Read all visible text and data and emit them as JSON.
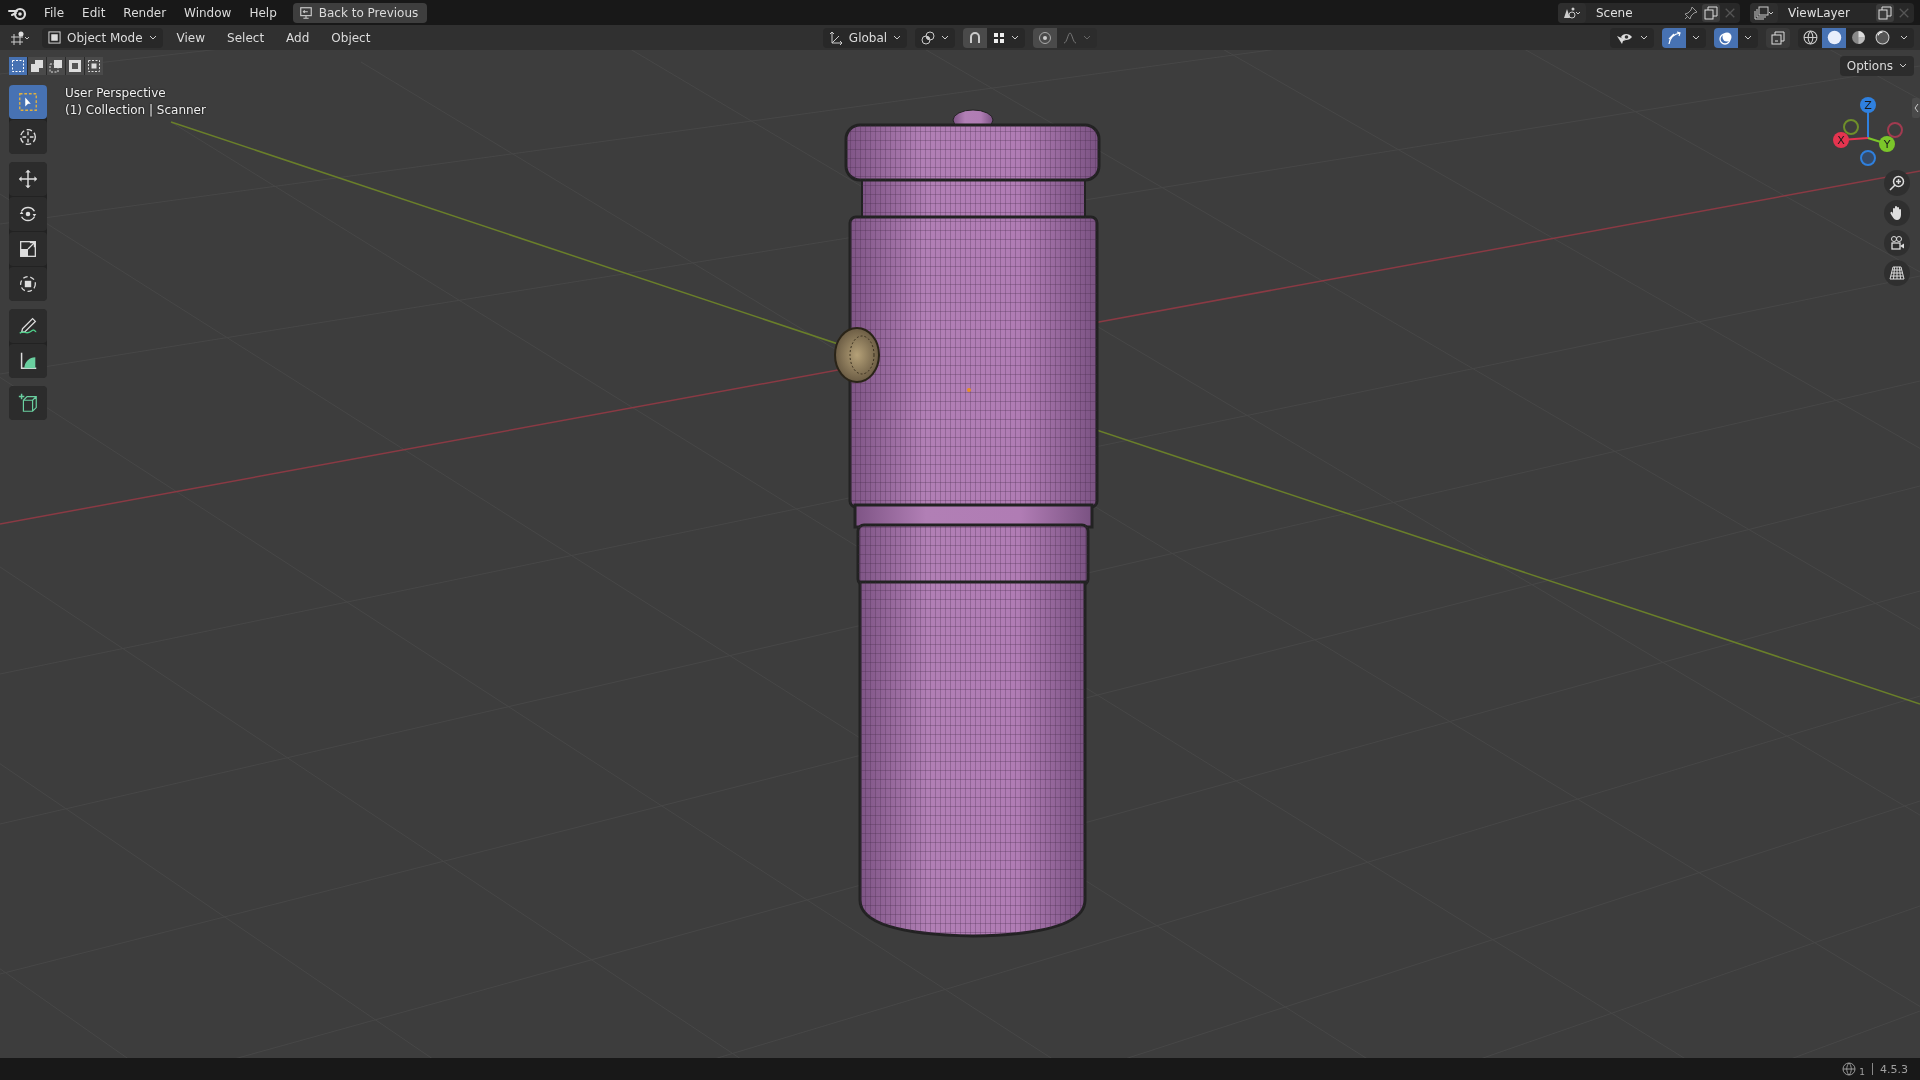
{
  "topbar": {
    "menus": [
      "File",
      "Edit",
      "Render",
      "Window",
      "Help"
    ],
    "back_button": "Back to Previous",
    "scene": "Scene",
    "view_layer": "ViewLayer"
  },
  "header": {
    "mode": "Object Mode",
    "menus": [
      "View",
      "Select",
      "Add",
      "Object"
    ],
    "orientation": "Global",
    "snap": {
      "on": false
    },
    "proportional": {
      "on": false
    },
    "gizmos": {
      "on": true
    },
    "overlays": {
      "on": true
    },
    "xray": {
      "on": false
    },
    "shading": [
      {
        "kind": "wireframe",
        "selected": false
      },
      {
        "kind": "solid",
        "selected": true
      },
      {
        "kind": "material",
        "selected": false
      },
      {
        "kind": "rendered",
        "selected": false
      }
    ]
  },
  "select_modes": [
    {
      "kind": "new",
      "selected": true
    },
    {
      "kind": "extend",
      "selected": false
    },
    {
      "kind": "subtract",
      "selected": false
    },
    {
      "kind": "invert",
      "selected": false
    },
    {
      "kind": "intersect",
      "selected": false
    }
  ],
  "toolbar": {
    "groups": [
      [
        {
          "kind": "select",
          "selected": true
        },
        {
          "kind": "cursor",
          "selected": false
        }
      ],
      [
        {
          "kind": "move",
          "selected": false
        },
        {
          "kind": "rotate",
          "selected": false
        },
        {
          "kind": "scale",
          "selected": false
        },
        {
          "kind": "transform",
          "selected": false
        }
      ],
      [
        {
          "kind": "annotate",
          "selected": false
        },
        {
          "kind": "measure",
          "selected": false
        }
      ],
      [
        {
          "kind": "add-cube",
          "selected": false
        }
      ]
    ]
  },
  "viewport": {
    "view_name": "User Perspective",
    "object_info": "(1) Collection | Scanner",
    "options": "Options",
    "axes": [
      {
        "label": "Z",
        "color": "#2f80de"
      },
      {
        "label": "X",
        "color": "#e5344f"
      },
      {
        "label": "Y",
        "color": "#7bc62a"
      }
    ]
  },
  "status_bar": {
    "scene_count": "1",
    "version": "4.5.3"
  }
}
